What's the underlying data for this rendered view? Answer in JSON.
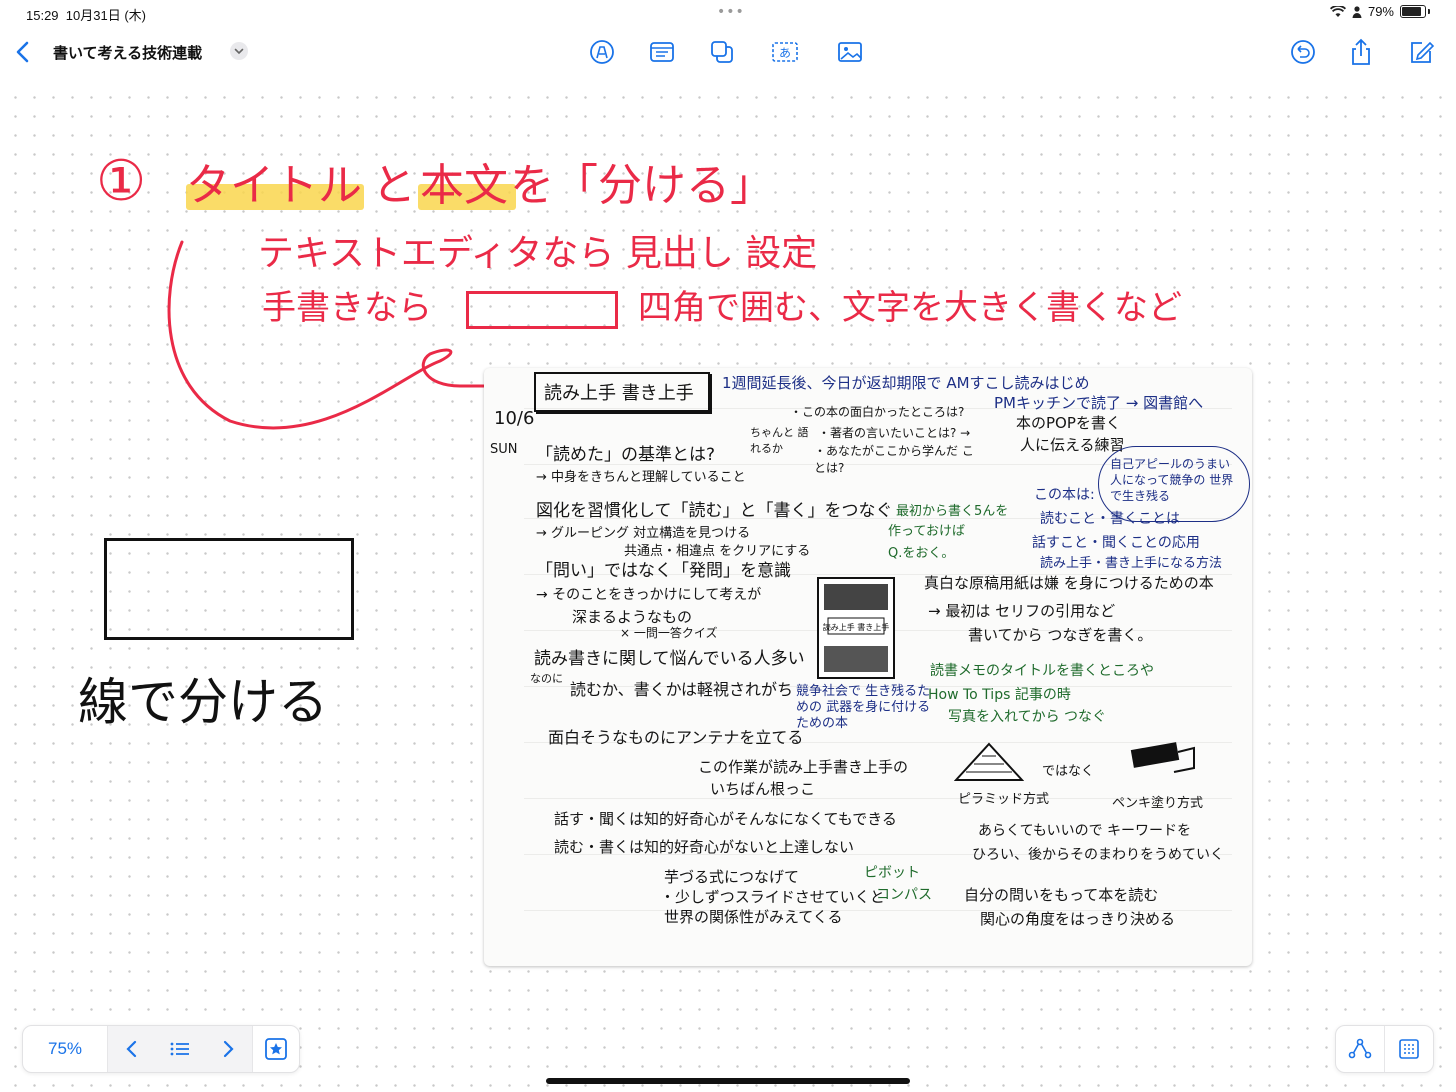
{
  "status_bar": {
    "time": "15:29",
    "date": "10月31日 (木)",
    "battery": "79%",
    "grabber": "•••"
  },
  "toolbar": {
    "title": "書いて考える技術連載",
    "tools": [
      "pen-tool-icon",
      "text-box-icon",
      "shapes-icon",
      "text-style-icon",
      "media-icon"
    ],
    "right_tools": [
      "undo-icon",
      "share-icon",
      "compose-icon"
    ],
    "accent": "#1a73e8"
  },
  "canvas": {
    "heading": {
      "number": "①",
      "part1": "タイトル",
      "part2": "と",
      "part3": "本文",
      "part4": "を「分ける」"
    },
    "line1": "テキストエディタなら 見出し 設定",
    "line2a": "手書きなら",
    "line2b": "四角で囲む、文字を大きく書くなど",
    "left_caption": "線で分ける",
    "red_color": "#ea2a47",
    "highlight_color": "#f9d64d"
  },
  "notebook": {
    "title": "読み上手 書き上手",
    "date_num": "10/6",
    "date_day": "SUN",
    "blue1": "1週間延長後、今日が返却期限で AMすこし読みはじめ",
    "blue2": "PMキッチンで読了 → 図書館へ",
    "k1": "・この本の面白かったところは?",
    "k2": "ちゃんと 語れるか",
    "k3": "・著者の言いたいことは? →",
    "k4": "・あなたがここから学んだ ことは?",
    "k5": "本のPOPを書く",
    "k6": "人に伝える練習",
    "q1": "「読めた」の基準とは?",
    "q2": "→ 中身をきちんと理解していること",
    "q3": "図化を習慣化して「読む」と「書く」をつなぐ",
    "q4": "→ グルーピング 対立構造を見つける",
    "q5": "共通点・相違点 をクリアにする",
    "q6": "「問い」ではなく「発問」を意識",
    "q7": "→ そのことをきっかけにして考えが",
    "q8": "深まるようなもの",
    "q9": "× 一問一答クイズ",
    "q10": "読み書きに関して悩んでいる人多い",
    "q11": "なのに",
    "q12": "読むか、書くかは軽視されがち",
    "g1": "最初から書く5んを",
    "g2": "作っておけば",
    "g3": "Q.をおく。",
    "b1": "この本は:",
    "b2": "自己アピールのうまい 人になって競争の 世界で生き残る",
    "b3": "読むこと・書くことは",
    "b4": "話すこと・聞くことの応用",
    "b5": "読み上手・書き上手になる方法",
    "k7": "真白な原稿用紙は嫌 を身につけるための本",
    "k8": "→ 最初は セリフの引用など",
    "k9": "書いてから つなぎを書く。",
    "g4": "読書メモのタイトルを書くところや",
    "g5": "How To Tips 記事の時",
    "g6": "写真を入れてから つなぐ",
    "b6": "競争社会で 生き残るための 武器を身に付ける ための本",
    "k10": "面白そうなものにアンテナを立てる",
    "k11": "この作業が読み上手書き上手の",
    "k12": "いちばん根っこ",
    "k13": "ではなく",
    "k14": "ピラミッド方式",
    "k15": "ペンキ塗り方式",
    "k16": "話す・聞くは知的好奇心がそんなになくてもできる",
    "k17": "読む・書くは知的好奇心がないと上達しない",
    "k18": "あらくてもいいので キーワードを",
    "k19": "ひろい、後からそのまわりをうめていく",
    "k20": "芋づる式につなげて",
    "k21": "・少しずつスライドさせていくと",
    "k22": "世界の関係性がみえてくる",
    "g7": "ピボット",
    "g8": "コンパス",
    "k23": "自分の問いをもって本を読む",
    "k24": "関心の角度をはっきり決める",
    "illustration_label": "読み上手 書き上手"
  },
  "bottom_bar": {
    "zoom": "75%",
    "items": [
      "chevron-left-icon",
      "list-icon",
      "chevron-right-icon",
      "favorite-star-icon"
    ],
    "right_items": [
      "connector-icon",
      "grid-icon"
    ]
  }
}
